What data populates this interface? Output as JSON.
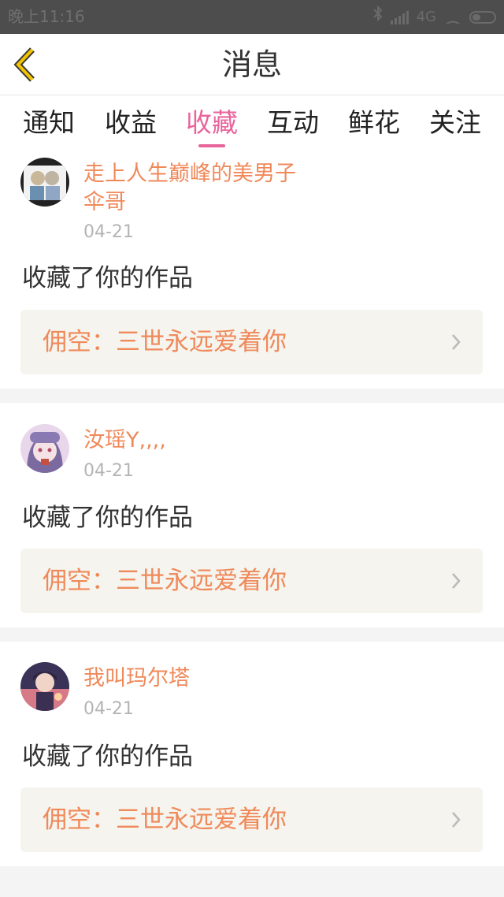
{
  "status_bar": {
    "time": "晚上11:16",
    "network": "4G",
    "icons": [
      "bluetooth-icon",
      "signal-icon",
      "wifi-icon",
      "battery-icon"
    ]
  },
  "header": {
    "title": "消息",
    "back_icon": "chevron-left-icon"
  },
  "tabs": [
    {
      "label": "通知",
      "active": false
    },
    {
      "label": "收益",
      "active": false
    },
    {
      "label": "收藏",
      "active": true
    },
    {
      "label": "互动",
      "active": false
    },
    {
      "label": "鲜花",
      "active": false
    },
    {
      "label": "关注",
      "active": false
    }
  ],
  "messages": [
    {
      "username_line1": "走上人生巅峰的美男子",
      "username_line2": "伞哥",
      "date": "04-21",
      "action": "收藏了你的作品",
      "work_title": "佣空：三世永远爱着你"
    },
    {
      "username_line1": "汝瑶Y,,,,",
      "date": "04-21",
      "action": "收藏了你的作品",
      "work_title": "佣空：三世永远爱着你"
    },
    {
      "username_line1": "我叫玛尔塔",
      "date": "04-21",
      "action": "收藏了你的作品",
      "work_title": "佣空：三世永远爱着你"
    }
  ],
  "colors": {
    "accent_pink": "#e8659c",
    "username_orange": "#f0895a",
    "link_background": "#f5f4ee"
  }
}
